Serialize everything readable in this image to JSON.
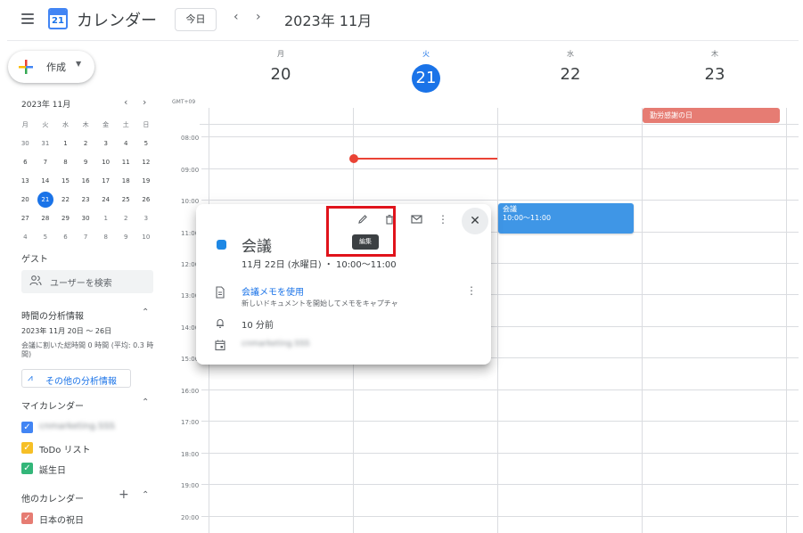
{
  "header": {
    "app_title": "カレンダー",
    "logo_day": "21",
    "today_label": "今日",
    "prev": "‹",
    "next": "›",
    "current_range": "2023年 11月"
  },
  "sidebar": {
    "create_label": "作成",
    "mini_calendar": {
      "title": "2023年 11月",
      "prev": "‹",
      "next": "›",
      "weekdays": [
        "月",
        "火",
        "水",
        "木",
        "金",
        "土",
        "日"
      ],
      "weeks": [
        [
          "30",
          "31",
          "1",
          "2",
          "3",
          "4",
          "5"
        ],
        [
          "6",
          "7",
          "8",
          "9",
          "10",
          "11",
          "12"
        ],
        [
          "13",
          "14",
          "15",
          "16",
          "17",
          "18",
          "19"
        ],
        [
          "20",
          "21",
          "22",
          "23",
          "24",
          "25",
          "26"
        ],
        [
          "27",
          "28",
          "29",
          "30",
          "1",
          "2",
          "3"
        ],
        [
          "4",
          "5",
          "6",
          "7",
          "8",
          "9",
          "10"
        ]
      ],
      "selected": "21"
    },
    "guest_title": "ゲスト",
    "guest_search_placeholder": "ユーザーを検索",
    "insights": {
      "title": "時間の分析情報",
      "range": "2023年 11月 20日 ～ 26日",
      "description": "会議に割いた総時間 0 時間 (平均: 0.3 時間)",
      "button_label": "その他の分析情報"
    },
    "my_calendars": {
      "title": "マイカレンダー",
      "items": [
        {
          "label": "cnmarketing.SSS",
          "color": "#4285f4"
        },
        {
          "label": "ToDo リスト",
          "color": "#f6bf26"
        },
        {
          "label": "誕生日",
          "color": "#33b679"
        }
      ]
    },
    "other_calendars": {
      "title": "他のカレンダー",
      "add": "+",
      "items": [
        {
          "label": "日本の祝日",
          "color": "#e67c73"
        }
      ]
    }
  },
  "grid": {
    "timezone": "GMT+09",
    "days": [
      {
        "dow": "月",
        "num": "20"
      },
      {
        "dow": "火",
        "num": "21",
        "today": true
      },
      {
        "dow": "水",
        "num": "22"
      },
      {
        "dow": "木",
        "num": "23"
      }
    ],
    "times": [
      "08:00",
      "09:00",
      "10:00",
      "11:00",
      "12:00",
      "13:00",
      "14:00",
      "15:00",
      "16:00",
      "17:00",
      "18:00",
      "19:00",
      "20:00"
    ],
    "holiday": "勤労感謝の日",
    "event": {
      "title": "会議",
      "time": "10:00～11:00",
      "color": "#3f96e6"
    }
  },
  "popup": {
    "title": "会議",
    "date_line": "11月 22日 (水曜日) ・ 10:00～11:00",
    "tooltip": "編集",
    "doc_link": "会議メモを使用",
    "doc_desc": "新しいドキュメントを開始してメモをキャプチャ",
    "reminder": "10 分前",
    "owner": "cnmarketing.SSS",
    "icons": [
      "pencil-icon",
      "trash-icon",
      "email-icon",
      "more-vert-icon",
      "close-icon"
    ]
  }
}
